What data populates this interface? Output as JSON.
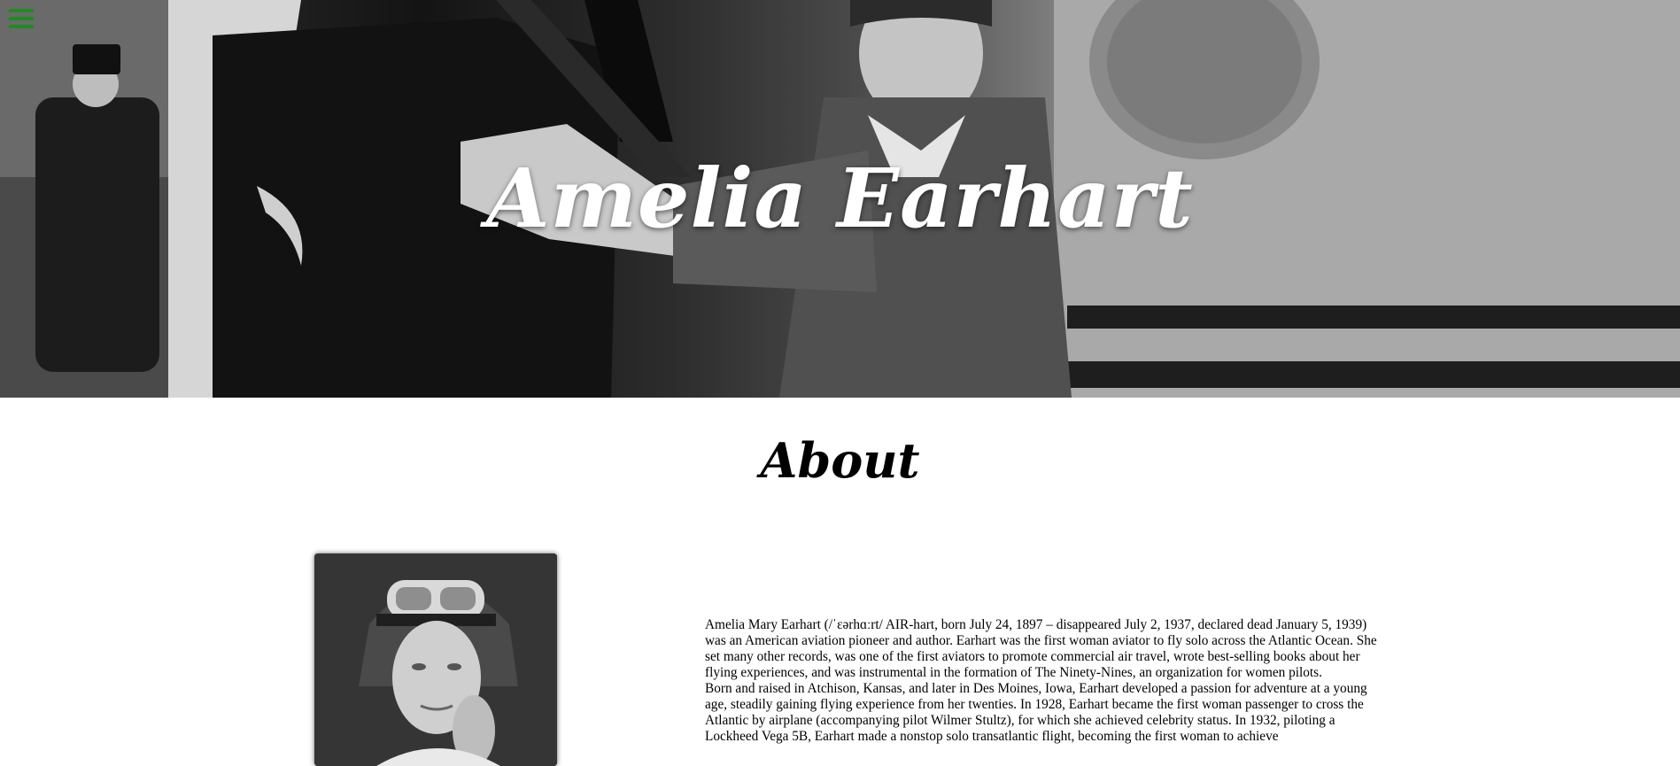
{
  "hero": {
    "title": "Amelia Earhart",
    "menu_icon": "hamburger-menu-icon",
    "menu_color": "#1e8c1e"
  },
  "about": {
    "heading": "About",
    "portrait_icon": "amelia-portrait-photo",
    "paragraphs": [
      "Amelia Mary Earhart (/ˈɛərhɑːrt/ AIR-hart, born July 24, 1897 – disappeared July 2, 1937, declared dead January 5, 1939) was an American aviation pioneer and author. Earhart was the first woman aviator to fly solo across the Atlantic Ocean. She set many other records, was one of the first aviators to promote commercial air travel, wrote best-selling books about her flying experiences, and was instrumental in the formation of The Ninety-Nines, an organization for women pilots.",
      "Born and raised in Atchison, Kansas, and later in Des Moines, Iowa, Earhart developed a passion for adventure at a young age, steadily gaining flying experience from her twenties. In 1928, Earhart became the first woman passenger to cross the Atlantic by airplane (accompanying pilot Wilmer Stultz), for which she achieved celebrity status. In 1932, piloting a Lockheed Vega 5B, Earhart made a nonstop solo transatlantic flight, becoming the first woman to achieve"
    ]
  }
}
